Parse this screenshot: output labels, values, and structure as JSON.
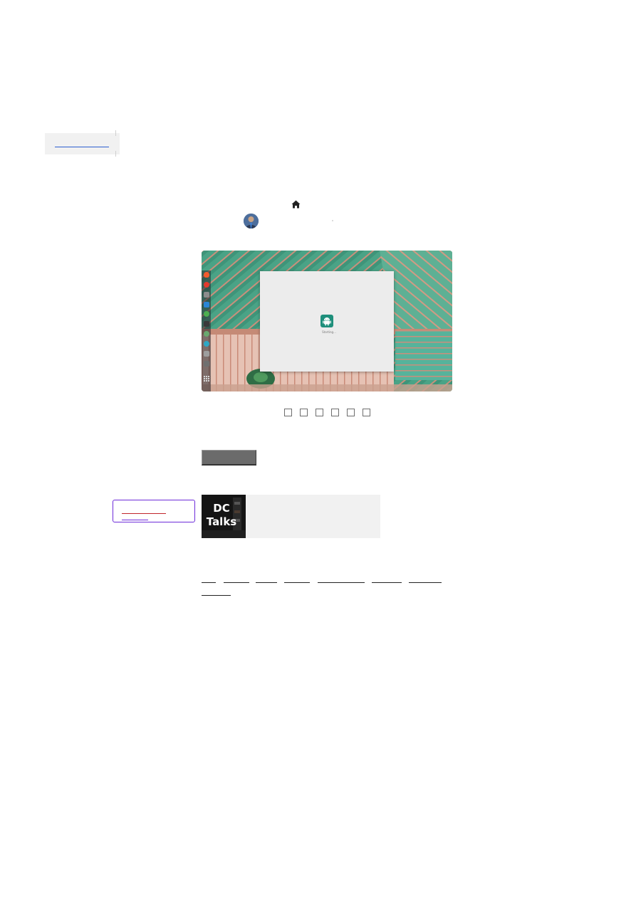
{
  "page": {
    "background": "#ffffff"
  },
  "skip_link": {
    "label": "",
    "color": "#2c5fd0"
  },
  "post_meta": {
    "home_icon": "home-icon",
    "author_avatar": "avatar"
  },
  "featured_screenshot": {
    "wallpaper": "aerial-farmland",
    "dock_icons": [
      "brave-icon",
      "vivaldi-icon",
      "files-icon",
      "vscode-icon",
      "ubuntu-software-icon",
      "terminal-icon",
      "settings-icon",
      "help-icon",
      "store-icon",
      "trash-icon",
      "apps-grid-icon"
    ],
    "app_window": {
      "app_icon": "android-icon",
      "status_text": "Starting..."
    }
  },
  "share_buttons": [
    "share-1",
    "share-2",
    "share-3",
    "share-4",
    "share-5",
    "share-6"
  ],
  "action_button": {
    "label": "",
    "color": "#6b6b6b"
  },
  "sidebar_link": {
    "label": "",
    "accent": "#6d2bd9"
  },
  "promo_card": {
    "thumb_line1": "DC",
    "thumb_line2": "Talks",
    "background": "#f1f1f1"
  },
  "tags": [
    "",
    "",
    "",
    "",
    "",
    "",
    "",
    ""
  ]
}
